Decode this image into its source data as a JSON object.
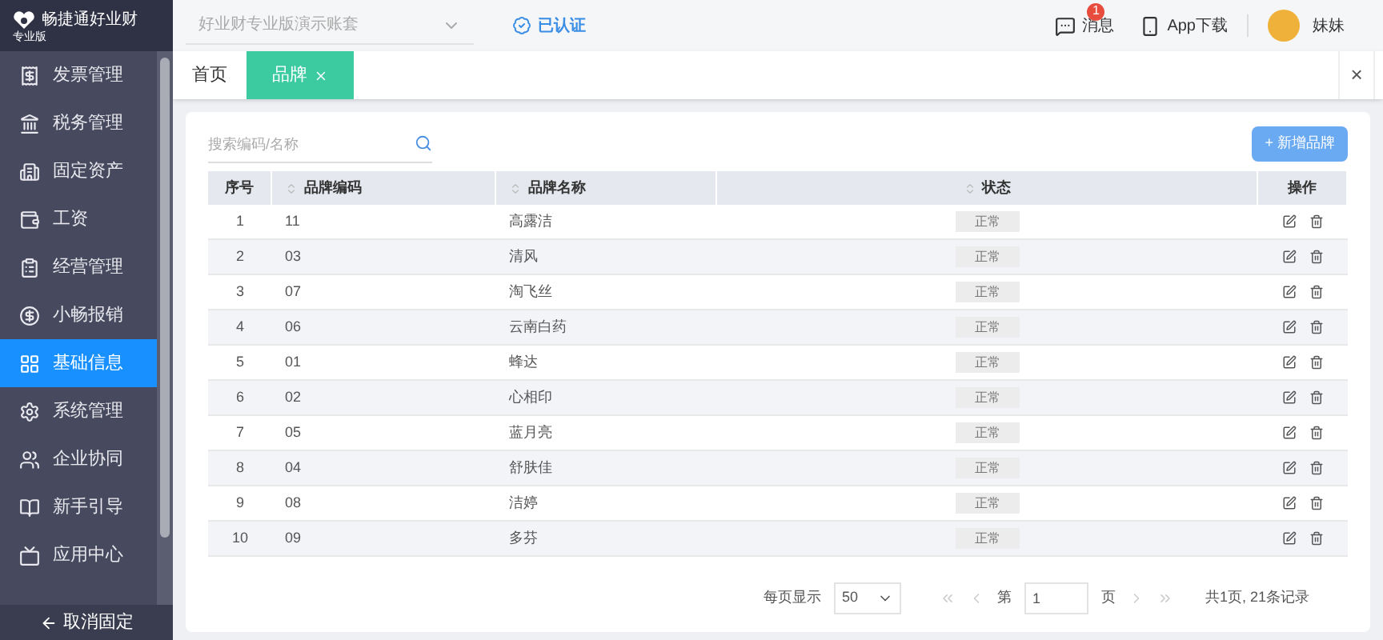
{
  "logo": {
    "name": "畅捷通好业财",
    "edition": "专业版"
  },
  "header": {
    "account": "好业财专业版演示账套",
    "certified": "已认证",
    "messages": {
      "label": "消息",
      "badge": "1"
    },
    "app_download": "App下载",
    "user": "妹妹"
  },
  "sidebar": {
    "items": [
      {
        "label": "发票管理",
        "selected": false
      },
      {
        "label": "税务管理",
        "selected": false
      },
      {
        "label": "固定资产",
        "selected": false
      },
      {
        "label": "工资",
        "selected": false
      },
      {
        "label": "经营管理",
        "selected": false
      },
      {
        "label": "小畅报销",
        "selected": false
      },
      {
        "label": "基础信息",
        "selected": true
      },
      {
        "label": "系统管理",
        "selected": false
      },
      {
        "label": "企业协同",
        "selected": false
      },
      {
        "label": "新手引导",
        "selected": false
      },
      {
        "label": "应用中心",
        "selected": false
      }
    ],
    "unpin": "取消固定"
  },
  "tabs": [
    {
      "label": "首页",
      "selected": false,
      "closable": false
    },
    {
      "label": "品牌",
      "selected": true,
      "closable": true
    }
  ],
  "tab_close": "×",
  "search": {
    "placeholder": "搜索编码/名称"
  },
  "add_button": "+ 新增品牌",
  "table": {
    "columns": [
      "序号",
      "品牌编码",
      "品牌名称",
      "状态",
      "操作"
    ],
    "rows": [
      [
        "1",
        "11",
        "高露洁",
        "正常"
      ],
      [
        "2",
        "03",
        "清风",
        "正常"
      ],
      [
        "3",
        "07",
        "淘飞丝",
        "正常"
      ],
      [
        "4",
        "06",
        "云南白药",
        "正常"
      ],
      [
        "5",
        "01",
        "蜂达",
        "正常"
      ],
      [
        "6",
        "02",
        "心相印",
        "正常"
      ],
      [
        "7",
        "05",
        "蓝月亮",
        "正常"
      ],
      [
        "8",
        "04",
        "舒肤佳",
        "正常"
      ],
      [
        "9",
        "08",
        "洁婷",
        "正常"
      ],
      [
        "10",
        "09",
        "多芬",
        "正常"
      ]
    ]
  },
  "pagination": {
    "per_page_label": "每页显示",
    "per_page": "50",
    "page_prefix": "第",
    "page": "1",
    "page_suffix": "页",
    "summary": "共1页, 21条记录"
  }
}
